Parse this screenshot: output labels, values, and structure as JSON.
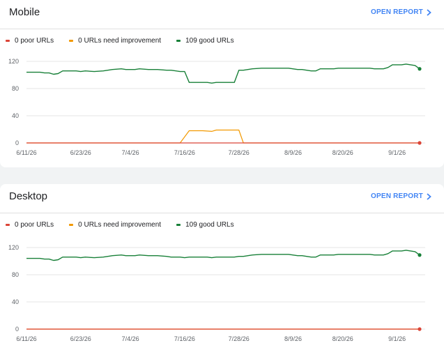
{
  "colors": {
    "poor": "#db4437",
    "needs_improvement": "#f29900",
    "good": "#188038",
    "accent": "#4285f4",
    "grid": "#e6e6e6"
  },
  "open_report_label": "OPEN REPORT",
  "icons": {
    "open_report": "chevron-right-icon"
  },
  "cards": [
    {
      "title": "Mobile",
      "legend": [
        {
          "label": "0 poor URLs",
          "key": "poor"
        },
        {
          "label": "0 URLs need improvement",
          "key": "needs_improvement"
        },
        {
          "label": "109 good URLs",
          "key": "good"
        }
      ]
    },
    {
      "title": "Desktop",
      "legend": [
        {
          "label": "0 poor URLs",
          "key": "poor"
        },
        {
          "label": "0 URLs need improvement",
          "key": "needs_improvement"
        },
        {
          "label": "109 good URLs",
          "key": "good"
        }
      ]
    }
  ],
  "chart_data": [
    {
      "type": "line",
      "x_tick_labels": [
        "6/11/26",
        "6/23/26",
        "7/4/26",
        "7/16/26",
        "7/28/26",
        "8/9/26",
        "8/20/26",
        "9/1/26"
      ],
      "y_ticks": [
        0,
        40,
        80,
        120
      ],
      "ylim": [
        0,
        120
      ],
      "grid": true,
      "legend_position": "top-left",
      "series": [
        {
          "name": "0 poor URLs",
          "key": "poor",
          "points": [
            [
              "6/11/26",
              0
            ],
            [
              "9/6/26",
              0
            ]
          ]
        },
        {
          "name": "0 URLs need improvement",
          "key": "needs_improvement",
          "points": [
            [
              "6/11/26",
              0
            ],
            [
              "7/15/26",
              0
            ],
            [
              "7/17/26",
              18
            ],
            [
              "7/20/26",
              18
            ],
            [
              "7/22/26",
              17
            ],
            [
              "7/23/26",
              19
            ],
            [
              "7/27/26",
              19
            ],
            [
              "7/28/26",
              19
            ],
            [
              "7/29/26",
              0
            ],
            [
              "9/6/26",
              0
            ]
          ]
        },
        {
          "name": "109 good URLs",
          "key": "good",
          "points": [
            [
              "6/11/26",
              104
            ],
            [
              "6/14/26",
              104
            ],
            [
              "6/15/26",
              103
            ],
            [
              "6/16/26",
              103
            ],
            [
              "6/17/26",
              101
            ],
            [
              "6/18/26",
              102
            ],
            [
              "6/19/26",
              106
            ],
            [
              "6/22/26",
              106
            ],
            [
              "6/23/26",
              105
            ],
            [
              "6/24/26",
              106
            ],
            [
              "6/26/26",
              105
            ],
            [
              "6/28/26",
              106
            ],
            [
              "6/30/26",
              108
            ],
            [
              "7/2/26",
              109
            ],
            [
              "7/3/26",
              108
            ],
            [
              "7/5/26",
              108
            ],
            [
              "7/6/26",
              109
            ],
            [
              "7/8/26",
              108
            ],
            [
              "7/10/26",
              108
            ],
            [
              "7/12/26",
              107
            ],
            [
              "7/13/26",
              107
            ],
            [
              "7/15/26",
              105
            ],
            [
              "7/16/26",
              105
            ],
            [
              "7/17/26",
              89
            ],
            [
              "7/21/26",
              89
            ],
            [
              "7/22/26",
              88
            ],
            [
              "7/23/26",
              89
            ],
            [
              "7/27/26",
              89
            ],
            [
              "7/28/26",
              107
            ],
            [
              "7/29/26",
              107
            ],
            [
              "7/31/26",
              109
            ],
            [
              "8/2/26",
              110
            ],
            [
              "8/5/26",
              110
            ],
            [
              "8/8/26",
              110
            ],
            [
              "8/10/26",
              108
            ],
            [
              "8/11/26",
              108
            ],
            [
              "8/13/26",
              106
            ],
            [
              "8/14/26",
              106
            ],
            [
              "8/15/26",
              109
            ],
            [
              "8/18/26",
              109
            ],
            [
              "8/19/26",
              110
            ],
            [
              "8/23/26",
              110
            ],
            [
              "8/26/26",
              110
            ],
            [
              "8/27/26",
              109
            ],
            [
              "8/29/26",
              109
            ],
            [
              "8/30/26",
              111
            ],
            [
              "8/31/26",
              115
            ],
            [
              "9/2/26",
              115
            ],
            [
              "9/3/26",
              116
            ],
            [
              "9/5/26",
              114
            ],
            [
              "9/6/26",
              109
            ]
          ]
        }
      ],
      "end_markers": [
        "poor",
        "good"
      ]
    },
    {
      "type": "line",
      "x_tick_labels": [
        "6/11/26",
        "6/23/26",
        "7/4/26",
        "7/16/26",
        "7/28/26",
        "8/9/26",
        "8/20/26",
        "9/1/26"
      ],
      "y_ticks": [
        0,
        40,
        80,
        120
      ],
      "ylim": [
        0,
        120
      ],
      "grid": true,
      "legend_position": "top-left",
      "series": [
        {
          "name": "0 poor URLs",
          "key": "poor",
          "points": [
            [
              "6/11/26",
              0
            ],
            [
              "9/6/26",
              0
            ]
          ]
        },
        {
          "name": "0 URLs need improvement",
          "key": "needs_improvement",
          "points": [
            [
              "6/11/26",
              0
            ],
            [
              "9/6/26",
              0
            ]
          ]
        },
        {
          "name": "109 good URLs",
          "key": "good",
          "points": [
            [
              "6/11/26",
              104
            ],
            [
              "6/14/26",
              104
            ],
            [
              "6/15/26",
              103
            ],
            [
              "6/16/26",
              103
            ],
            [
              "6/17/26",
              101
            ],
            [
              "6/18/26",
              102
            ],
            [
              "6/19/26",
              106
            ],
            [
              "6/22/26",
              106
            ],
            [
              "6/23/26",
              105
            ],
            [
              "6/24/26",
              106
            ],
            [
              "6/26/26",
              105
            ],
            [
              "6/28/26",
              106
            ],
            [
              "6/30/26",
              108
            ],
            [
              "7/2/26",
              109
            ],
            [
              "7/3/26",
              108
            ],
            [
              "7/5/26",
              108
            ],
            [
              "7/6/26",
              109
            ],
            [
              "7/8/26",
              108
            ],
            [
              "7/10/26",
              108
            ],
            [
              "7/12/26",
              107
            ],
            [
              "7/13/26",
              106
            ],
            [
              "7/15/26",
              106
            ],
            [
              "7/16/26",
              105
            ],
            [
              "7/17/26",
              106
            ],
            [
              "7/21/26",
              106
            ],
            [
              "7/22/26",
              105
            ],
            [
              "7/23/26",
              106
            ],
            [
              "7/27/26",
              106
            ],
            [
              "7/28/26",
              107
            ],
            [
              "7/29/26",
              107
            ],
            [
              "7/31/26",
              109
            ],
            [
              "8/2/26",
              110
            ],
            [
              "8/5/26",
              110
            ],
            [
              "8/8/26",
              110
            ],
            [
              "8/10/26",
              108
            ],
            [
              "8/11/26",
              108
            ],
            [
              "8/13/26",
              106
            ],
            [
              "8/14/26",
              106
            ],
            [
              "8/15/26",
              109
            ],
            [
              "8/18/26",
              109
            ],
            [
              "8/19/26",
              110
            ],
            [
              "8/23/26",
              110
            ],
            [
              "8/26/26",
              110
            ],
            [
              "8/27/26",
              109
            ],
            [
              "8/29/26",
              109
            ],
            [
              "8/30/26",
              111
            ],
            [
              "8/31/26",
              115
            ],
            [
              "9/2/26",
              115
            ],
            [
              "9/3/26",
              116
            ],
            [
              "9/5/26",
              114
            ],
            [
              "9/6/26",
              109
            ]
          ]
        }
      ],
      "end_markers": [
        "poor",
        "good"
      ]
    }
  ]
}
